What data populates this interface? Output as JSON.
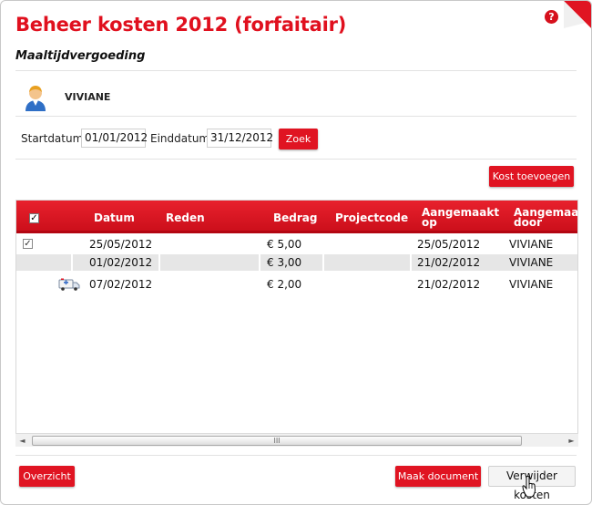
{
  "header": {
    "title": "Beheer kosten 2012 (forfaitair)",
    "subtitle": "Maaltijdvergoeding",
    "help_symbol": "?"
  },
  "user": {
    "name": "VIVIANE",
    "icon": "user-avatar-icon"
  },
  "filter": {
    "start_label": "Startdatum",
    "start_value": "01/01/2012",
    "end_label": "Einddatum",
    "end_value": "31/12/2012",
    "search_label": "Zoek"
  },
  "add_cost_label": "Kost toevoegen",
  "grid": {
    "columns": [
      {
        "label": "Datum"
      },
      {
        "label": "Reden"
      },
      {
        "label": "Bedrag"
      },
      {
        "label": "Projectcode"
      },
      {
        "label": "Aangemaakt op"
      },
      {
        "label": "Aangemaakt door"
      }
    ],
    "header_check": "✓",
    "rows": [
      {
        "checked": true,
        "date": "25/05/2012",
        "reason": "",
        "amount": "€ 5,00",
        "project": "",
        "created_on": "25/05/2012",
        "created_by": "VIVIANE",
        "icon": ""
      },
      {
        "checked": false,
        "date": "01/02/2012",
        "reason": "",
        "amount": "€ 3,00",
        "project": "",
        "created_on": "21/02/2012",
        "created_by": "VIVIANE",
        "icon": ""
      },
      {
        "checked": false,
        "date": "07/02/2012",
        "reason": "",
        "amount": "€ 2,00",
        "project": "",
        "created_on": "21/02/2012",
        "created_by": "VIVIANE",
        "icon": "ambulance-icon"
      }
    ]
  },
  "scrollbar": {
    "left_arrow": "◄",
    "right_arrow": "►",
    "grip": "III"
  },
  "footer": {
    "overview_label": "Overzicht",
    "make_document_label": "Maak document",
    "delete_costs_label": "Verwijder kosten"
  },
  "colors": {
    "accent": "#e01422",
    "row_alt": "#e6e6e6"
  }
}
